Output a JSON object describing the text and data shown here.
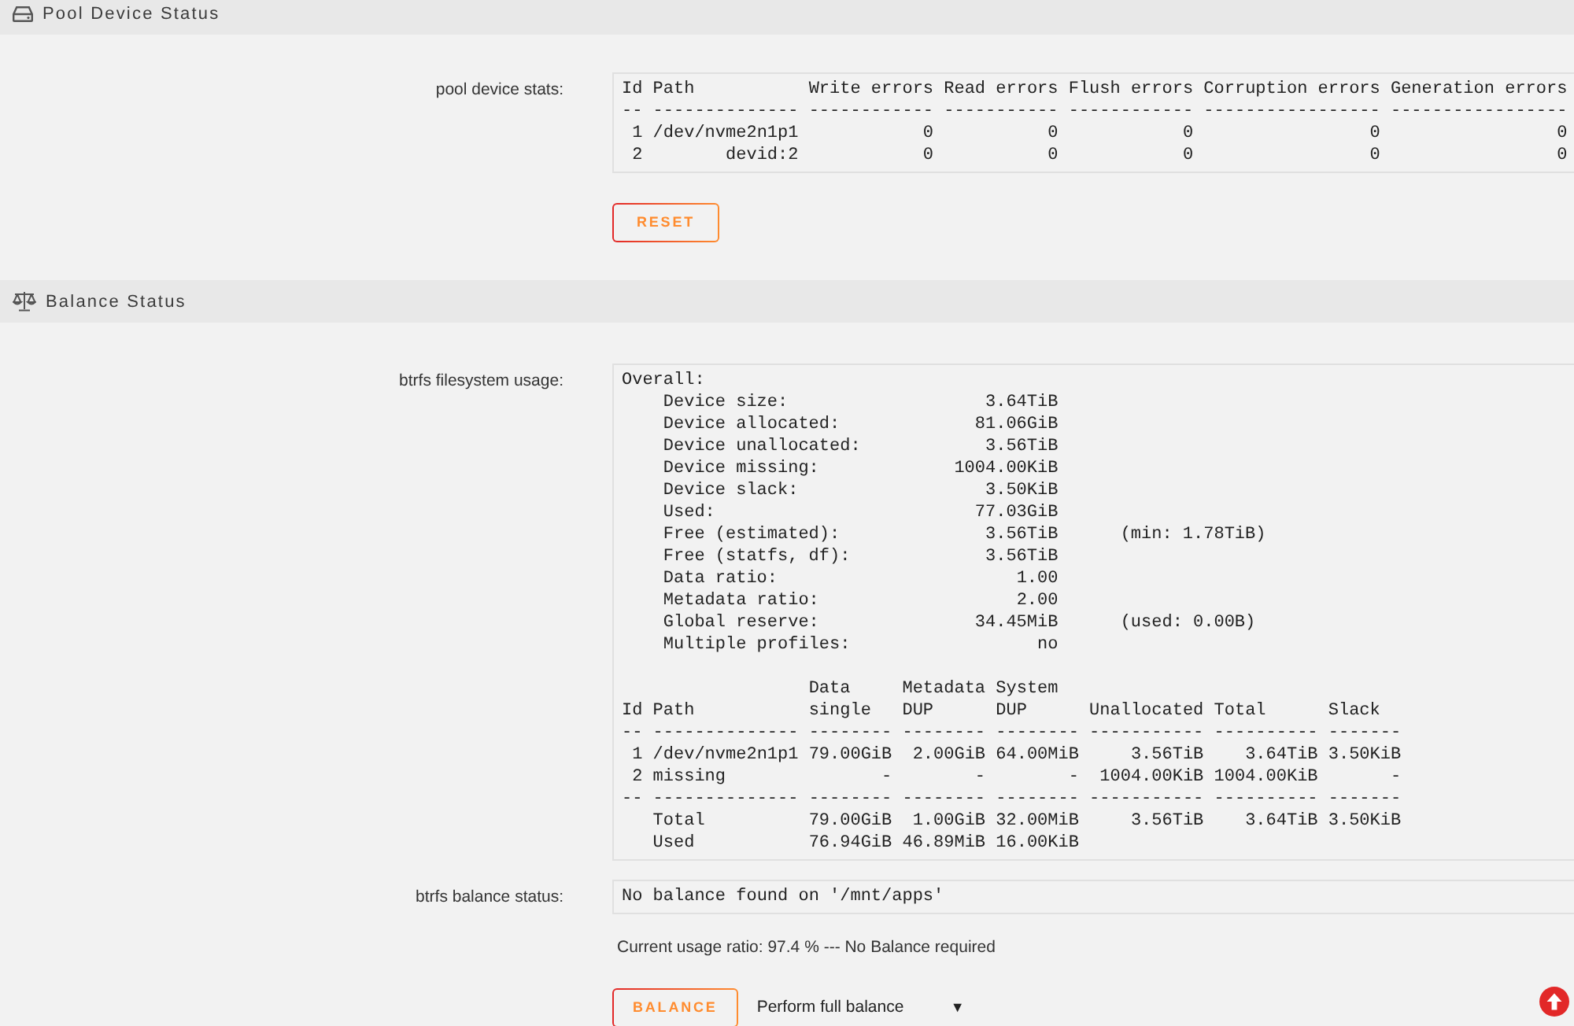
{
  "pool_device_status": {
    "title": "Pool Device Status",
    "stats": {
      "label": "pool device stats:",
      "lines": [
        "Id Path           Write errors Read errors Flush errors Corruption errors Generation errors",
        "-- -------------- ------------ ----------- ------------ ----------------- -----------------",
        " 1 /dev/nvme2n1p1            0           0            0                 0                 0",
        " 2        devid:2            0           0            0                 0                 0"
      ]
    },
    "reset_button": "RESET"
  },
  "balance_status": {
    "title": "Balance Status",
    "filesystem_usage": {
      "label": "btrfs filesystem usage:",
      "heading": "Overall:",
      "rows": [
        {
          "label": "Device size:",
          "value": "3.64TiB"
        },
        {
          "label": "Device allocated:",
          "value": "81.06GiB"
        },
        {
          "label": "Device unallocated:",
          "value": "3.56TiB"
        },
        {
          "label": "Device missing:",
          "value": "1004.00KiB"
        },
        {
          "label": "Device slack:",
          "value": "3.50KiB"
        },
        {
          "label": "Used:",
          "value": "77.03GiB"
        },
        {
          "label": "Free (estimated):",
          "value": "3.56TiB",
          "note": "(min: 1.78TiB)"
        },
        {
          "label": "Free (statfs, df):",
          "value": "3.56TiB"
        },
        {
          "label": "Data ratio:",
          "value": "1.00"
        },
        {
          "label": "Metadata ratio:",
          "value": "2.00"
        },
        {
          "label": "Global reserve:",
          "value": "34.45MiB",
          "note": "(used: 0.00B)"
        },
        {
          "label": "Multiple profiles:",
          "value": "no"
        }
      ],
      "table_lines": [
        "                  Data     Metadata System",
        "Id Path           single   DUP      DUP      Unallocated Total      Slack",
        "-- -------------- -------- -------- -------- ----------- ---------- -------",
        " 1 /dev/nvme2n1p1 79.00GiB  2.00GiB 64.00MiB     3.56TiB    3.64TiB 3.50KiB",
        " 2 missing               -        -        -  1004.00KiB 1004.00KiB       -",
        "-- -------------- -------- -------- -------- ----------- ---------- -------",
        "   Total          79.00GiB  1.00GiB 32.00MiB     3.56TiB    3.64TiB 3.50KiB",
        "   Used           76.94GiB 46.89MiB 16.00KiB"
      ]
    },
    "balance_state": {
      "label": "btrfs balance status:",
      "value": "No balance found on '/mnt/apps'"
    },
    "usage_ratio": "Current usage ratio: 97.4 % --- No Balance required",
    "balance_button": "BALANCE",
    "balance_mode": {
      "value": "Perform full balance",
      "caret": "▼"
    }
  }
}
